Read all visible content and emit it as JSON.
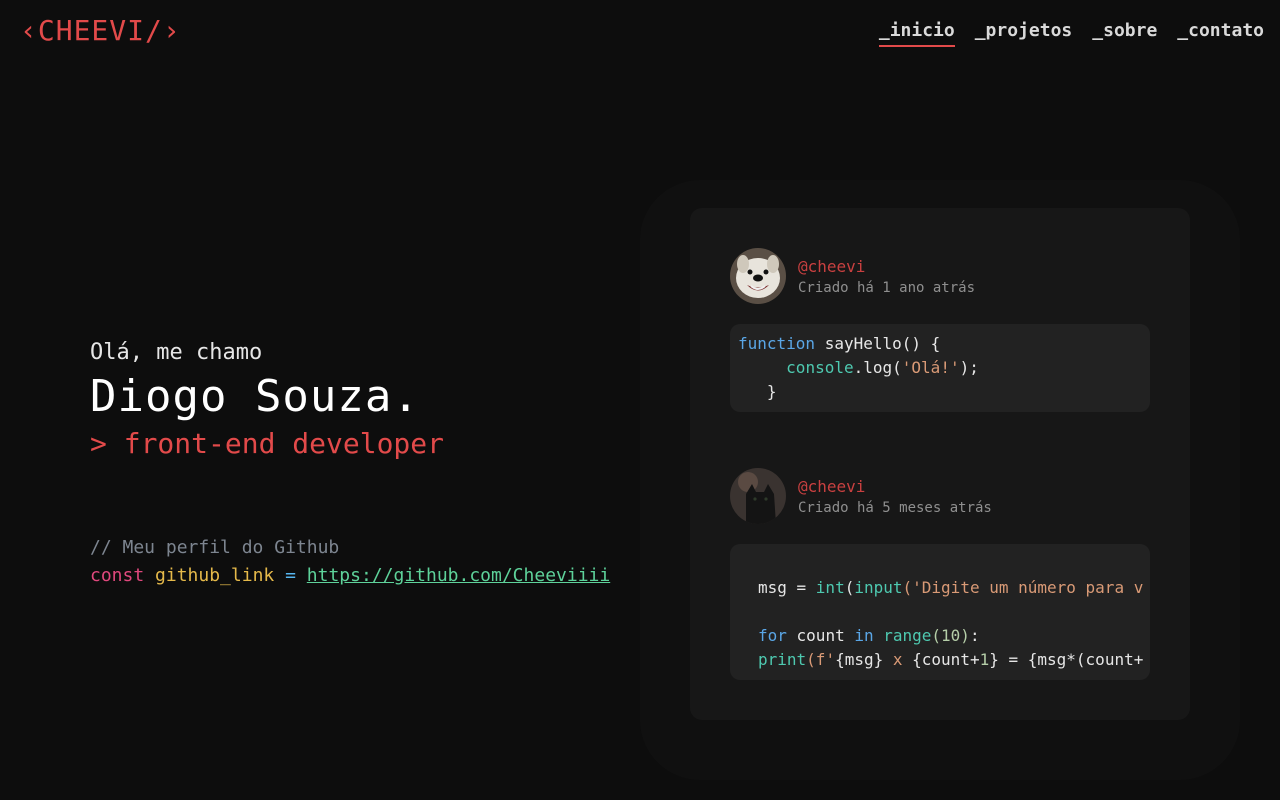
{
  "header": {
    "logo": "‹CHEEVI/›",
    "nav": [
      {
        "label": "_inicio",
        "active": true
      },
      {
        "label": "_projetos",
        "active": false
      },
      {
        "label": "_sobre",
        "active": false
      },
      {
        "label": "_contato",
        "active": false
      }
    ]
  },
  "hero": {
    "greeting": "Olá, me chamo",
    "name": "Diogo Souza.",
    "role": "> front-end developer"
  },
  "github": {
    "comment": "// Meu perfil do Github",
    "keyword": "const",
    "variable": "github_link",
    "operator": "=",
    "url": "https://github.com/Cheeviiii"
  },
  "posts": [
    {
      "handle": "@cheevi",
      "created": "Criado há 1 ano atrás",
      "avatar_icon": "smiling-dog-avatar",
      "code": {
        "l1_kw": "function",
        "l1_name": " sayHello() {",
        "l2_obj": "console",
        "l2_call": ".log(",
        "l2_str": "'Olá!'",
        "l2_end": ");",
        "l3": "}"
      }
    },
    {
      "handle": "@cheevi",
      "created": "Criado há 5 meses atrás",
      "avatar_icon": "black-cat-avatar",
      "code": {
        "l1_var": "msg = ",
        "l1_fn1": "int",
        "l1_p": "(",
        "l1_fn2": "input",
        "l1_str": "('Digite um número para v",
        "l2_kw1": "for",
        "l2_var": " count ",
        "l2_kw2": "in",
        "l2_fn": " range",
        "l2_num": "(10)",
        "l2_end": ":",
        "l3_fn": "print",
        "l3_str": "(f'",
        "l3_body": "{msg} ",
        "l3_x": "x",
        "l3_rest": " {count+",
        "l3_num": "1",
        "l3_tail": "} = {msg*(count+"
      }
    }
  ],
  "colors": {
    "accent": "#e24a4a",
    "background": "#0d0d0d",
    "card": "#171717",
    "code_bg": "#222222"
  }
}
